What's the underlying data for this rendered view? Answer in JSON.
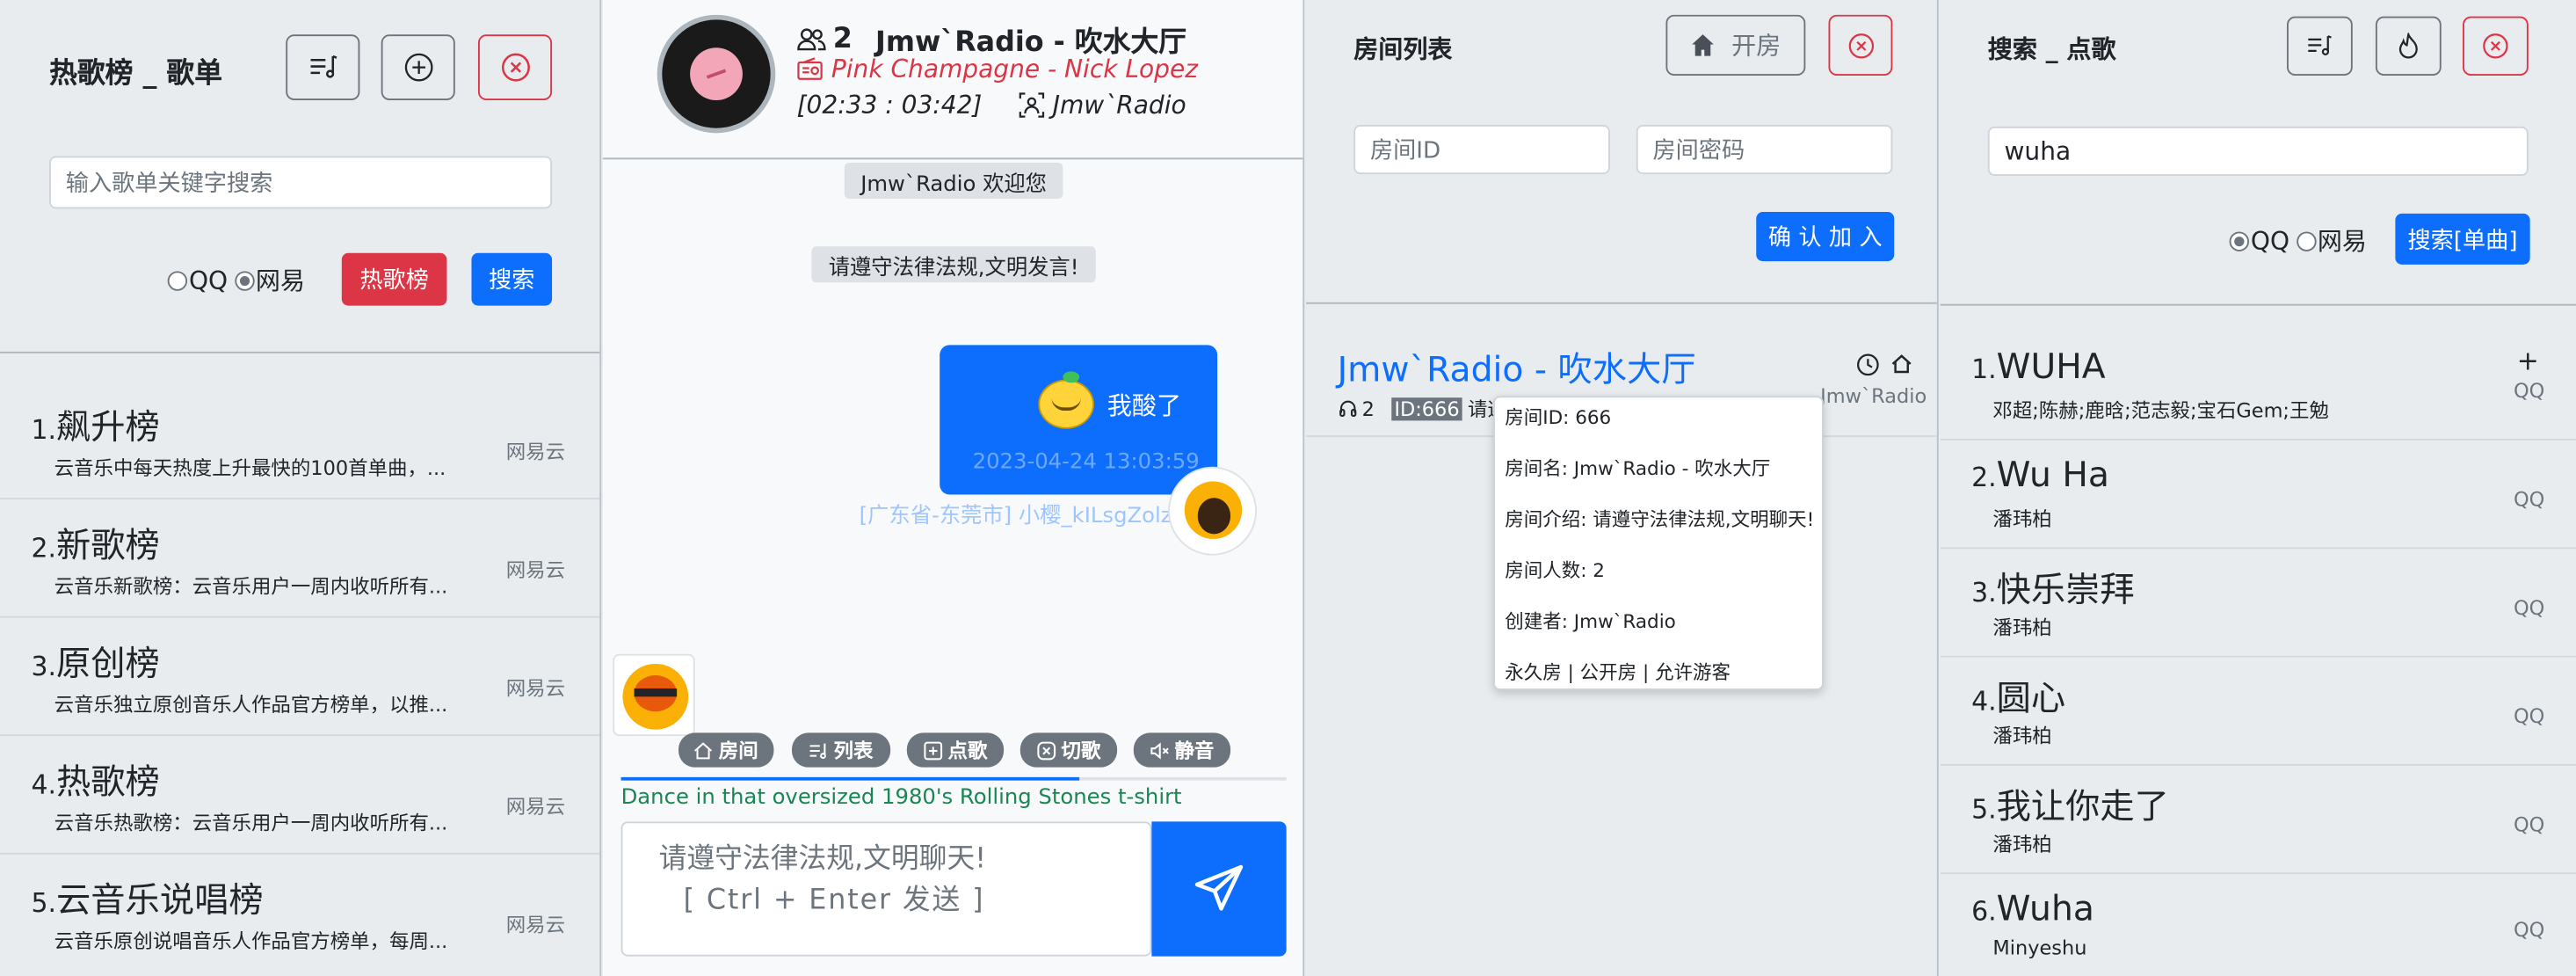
{
  "chart_panel": {
    "title": "热歌榜 _ 歌单",
    "search_placeholder": "输入歌单关键字搜索",
    "radio_qq": "QQ",
    "radio_netease": "网易",
    "hot_button": "热歌榜",
    "search_button": "搜索",
    "items": [
      {
        "num": "1.",
        "title": "飙升榜",
        "desc": "云音乐中每天热度上升最快的100首单曲，...",
        "source": "网易云"
      },
      {
        "num": "2.",
        "title": "新歌榜",
        "desc": "云音乐新歌榜：云音乐用户一周内收听所有...",
        "source": "网易云"
      },
      {
        "num": "3.",
        "title": "原创榜",
        "desc": "云音乐独立原创音乐人作品官方榜单，以推...",
        "source": "网易云"
      },
      {
        "num": "4.",
        "title": "热歌榜",
        "desc": "云音乐热歌榜：云音乐用户一周内收听所有...",
        "source": "网易云"
      },
      {
        "num": "5.",
        "title": "云音乐说唱榜",
        "desc": "云音乐原创说唱音乐人作品官方榜单，每周...",
        "source": "网易云"
      }
    ]
  },
  "chat_panel": {
    "listener_count": "2",
    "room_name": "Jmw`Radio - 吹水大厅",
    "now_playing": "Pink Champagne - Nick Lopez",
    "time_display": "[02:33 : 03:42]",
    "host": "Jmw`Radio",
    "welcome_msg": "Jmw`Radio 欢迎您",
    "rules_msg": "请遵守法律法规,文明发言!",
    "bubble_text": "我酸了",
    "bubble_time": "2023-04-24 13:03:59",
    "sender": "[广东省-东莞市] 小樱_kILsgZolz",
    "btn_room": "房间",
    "btn_list": "列表",
    "btn_pick": "点歌",
    "btn_skip": "切歌",
    "btn_mute": "静音",
    "lyric": "Dance in that oversized 1980's Rolling Stones t-shirt",
    "input_line1": "请遵守法律法规,文明聊天!",
    "input_line2": "[ Ctrl + Enter 发送 ]",
    "progress_pct": 69
  },
  "room_panel": {
    "title": "房间列表",
    "open_button": "开房",
    "room_id_placeholder": "房间ID",
    "room_pwd_placeholder": "房间密码",
    "join_button": "确 认 加 入",
    "room_title": "Jmw`Radio - 吹水大厅",
    "room_count": "2",
    "room_id_badge": "ID:666",
    "room_desc_short": "请遵",
    "room_owner_short": "Jmw`Radio",
    "tooltip": {
      "id": "房间ID: 666",
      "name": "房间名: Jmw`Radio - 吹水大厅",
      "intro": "房间介绍: 请遵守法律法规,文明聊天!",
      "people": "房间人数: 2",
      "creator": "创建者: Jmw`Radio",
      "flags": "永久房 | 公开房 | 允许游客"
    }
  },
  "search_panel": {
    "title": "搜索 _ 点歌",
    "search_value": "wuha",
    "radio_qq": "QQ",
    "radio_netease": "网易",
    "search_button": "搜索[单曲]",
    "items": [
      {
        "num": "1.",
        "title": "WUHA",
        "artist": "邓超;陈赫;鹿晗;范志毅;宝石Gem;王勉",
        "source": "QQ"
      },
      {
        "num": "2.",
        "title": "Wu Ha",
        "artist": "潘玮柏",
        "source": "QQ"
      },
      {
        "num": "3.",
        "title": "快乐崇拜",
        "artist": "潘玮柏",
        "source": "QQ"
      },
      {
        "num": "4.",
        "title": "圆心",
        "artist": "潘玮柏",
        "source": "QQ"
      },
      {
        "num": "5.",
        "title": "我让你走了",
        "artist": "潘玮柏",
        "source": "QQ"
      },
      {
        "num": "6.",
        "title": "Wuha",
        "artist": "Minyeshu",
        "source": "QQ"
      }
    ]
  }
}
